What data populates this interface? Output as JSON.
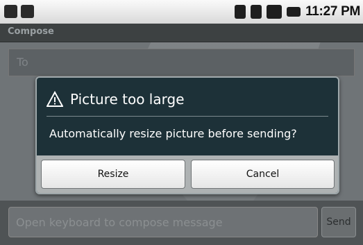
{
  "statusbar": {
    "time": "11:27 PM",
    "left_icons": [
      "notification-icon",
      "voicemail-icon"
    ],
    "right_icons": [
      "bluetooth-icon",
      "wifi-icon",
      "signal-icon",
      "battery-icon"
    ]
  },
  "app": {
    "title": "Compose",
    "to_placeholder": "To",
    "compose_placeholder": "Open keyboard to compose message",
    "send_label": "Send"
  },
  "dialog": {
    "title": "Picture too large",
    "message": "Automatically resize picture before sending?",
    "resize_label": "Resize",
    "cancel_label": "Cancel",
    "icon": "warning-icon"
  }
}
